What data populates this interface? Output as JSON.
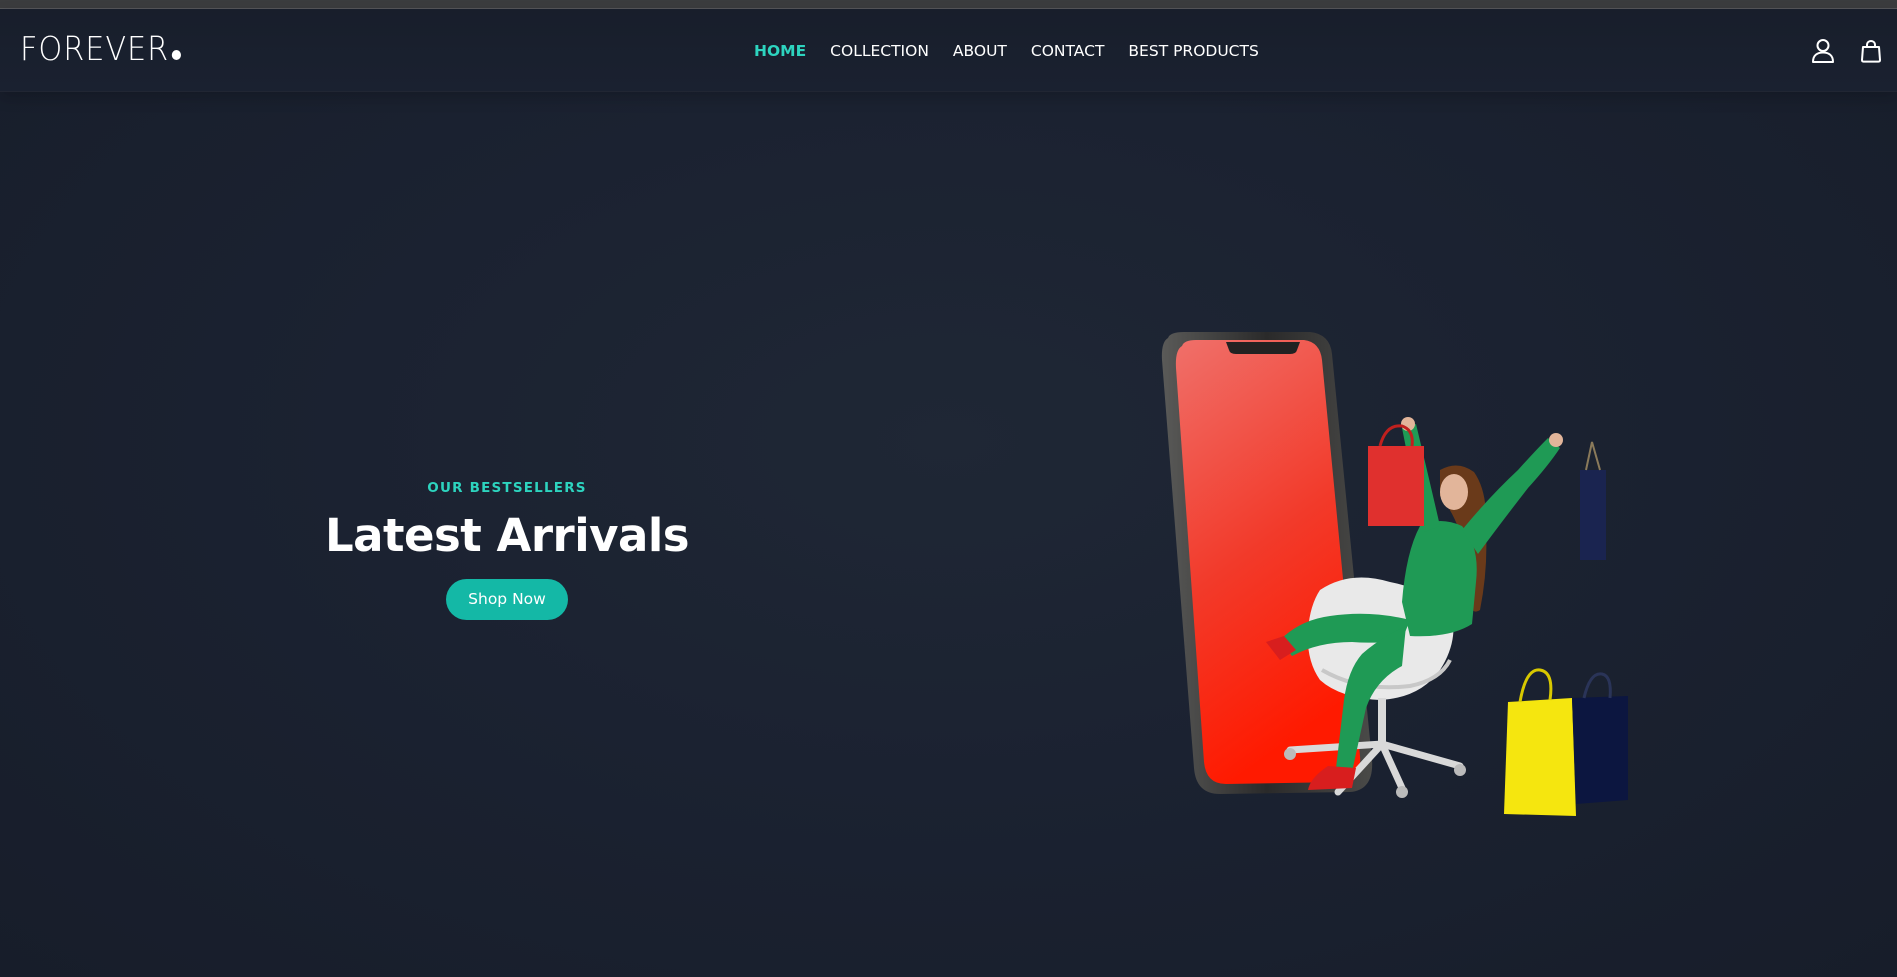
{
  "brand": {
    "logo_text": "FOREVER"
  },
  "nav": {
    "items": [
      {
        "label": "HOME",
        "active": true
      },
      {
        "label": "COLLECTION",
        "active": false
      },
      {
        "label": "ABOUT",
        "active": false
      },
      {
        "label": "CONTACT",
        "active": false
      },
      {
        "label": "BEST PRODUCTS",
        "active": false
      }
    ],
    "icons": [
      "user-icon",
      "shopping-bag-icon"
    ]
  },
  "hero": {
    "eyebrow": "OUR BESTSELLERS",
    "title": "Latest Arrivals",
    "cta_label": "Shop Now",
    "illustration": "woman-with-shopping-bags-and-phone-image"
  },
  "colors": {
    "background": "#1b2231",
    "accent": "#2dd4bf",
    "button": "#14b8a6",
    "text": "#ffffff"
  }
}
